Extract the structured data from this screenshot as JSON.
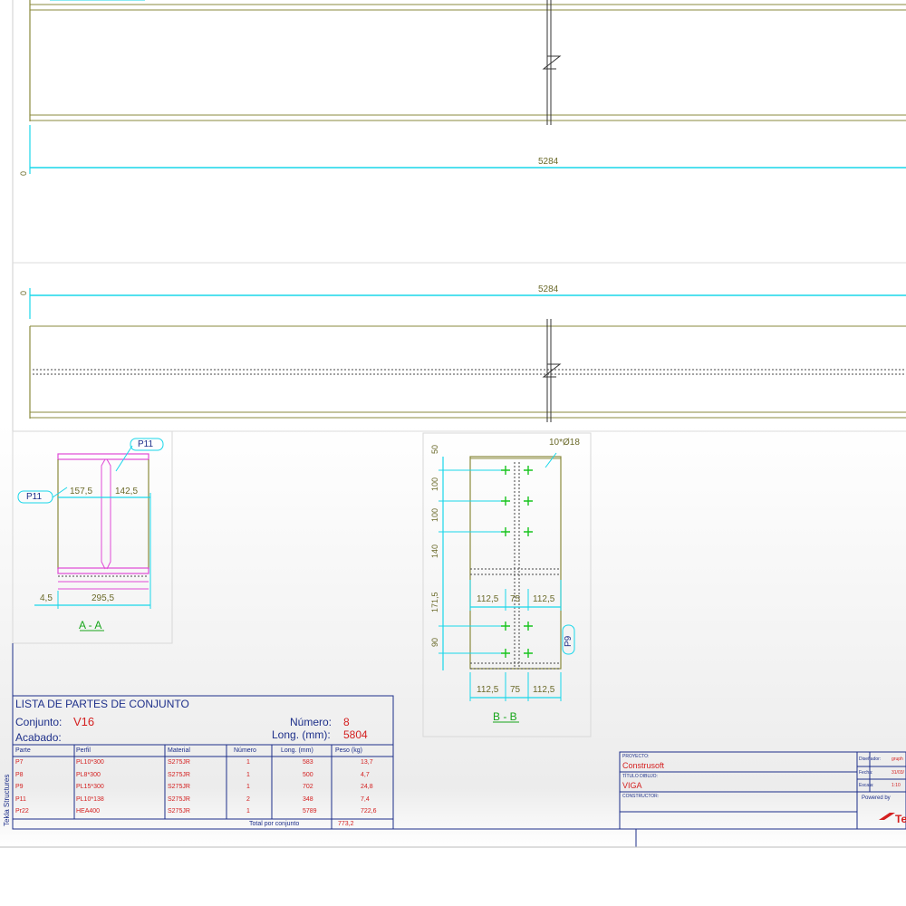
{
  "elevation": {
    "top_dimension": "5284",
    "top_origin": "0",
    "bottom_dimension": "5284",
    "bottom_origin": "0"
  },
  "section_aa": {
    "label_p11_top": "P11",
    "label_p11_left": "P11",
    "dim_left": "157,5",
    "dim_right": "142,5",
    "dim_bottom_small": "4,5",
    "dim_bottom_main": "295,5",
    "title": "A - A"
  },
  "section_bb": {
    "hole_note": "10*Ø18",
    "vertical_dims": [
      "50",
      "100",
      "100",
      "140",
      "171,5",
      "90"
    ],
    "mid_dims": [
      "112,5",
      "75",
      "112,5"
    ],
    "bottom_dims": [
      "112,5",
      "75",
      "112,5"
    ],
    "label_p9": "P9",
    "title": "B - B"
  },
  "parts_list": {
    "heading": "LISTA DE PARTES DE CONJUNTO",
    "conjunto_label": "Conjunto:",
    "conjunto_value": "V16",
    "acabado_label": "Acabado:",
    "numero_label": "Número:",
    "numero_value": "8",
    "long_label": "Long. (mm):",
    "long_value": "5804",
    "columns": [
      "Parte",
      "Perfil",
      "Material",
      "Número",
      "Long. (mm)",
      "Peso (kg)"
    ],
    "rows": [
      [
        "P7",
        "PL10*300",
        "S275JR",
        "1",
        "583",
        "13,7"
      ],
      [
        "P8",
        "PL8*300",
        "S275JR",
        "1",
        "500",
        "4,7"
      ],
      [
        "P9",
        "PL15*300",
        "S275JR",
        "1",
        "702",
        "24,8"
      ],
      [
        "P11",
        "PL10*138",
        "S275JR",
        "2",
        "348",
        "7,4"
      ],
      [
        "Pr22",
        "HEA400",
        "S275JR",
        "1",
        "5789",
        "722,6"
      ]
    ],
    "total_label": "Total por conjunto",
    "total_value": "773,2"
  },
  "side_label": "Tekla Structures",
  "title_block": {
    "proyecto_label": "PROYECTO:",
    "proyecto_value": "Construsoft",
    "titulo_label": "TÍTULO DIBUJO:",
    "titulo_value": "VIGA",
    "constructor_label": "CONSTRUCTOR:",
    "disenador_label": "Diseñador:",
    "disenador_value": "gruph",
    "fecha_label": "Fecha:",
    "fecha_value": "31/03/",
    "escala_label": "Escala:",
    "escala_value": "1:10",
    "powered_label": "Powered by",
    "logo_text": "Te"
  },
  "colors": {
    "dimension_line": "#19d7ea",
    "part_outline": "#8a8a3c",
    "section_pink": "#e04ad6",
    "bolt_green": "#18c41e",
    "text_blue": "#1d2f8a",
    "text_red": "#d42020"
  }
}
